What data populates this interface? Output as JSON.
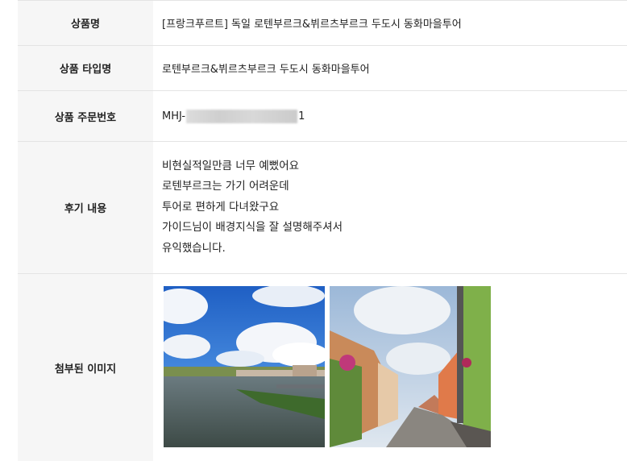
{
  "rows": {
    "product_name": {
      "label": "상품명",
      "value": "[프랑크푸르트] 독일 로텐부르크&뷔르츠부르크 두도시 동화마을투어"
    },
    "product_type": {
      "label": "상품 타입명",
      "value": "로텐부르크&뷔르츠부르크 두도시 동화마을투어"
    },
    "order_number": {
      "label": "상품 주문번호",
      "prefix": "MHJ-",
      "suffix": "1"
    },
    "review": {
      "label": "후기 내용",
      "lines": [
        "비현실적일만큼 너무 예뻤어요",
        "로텐부르크는 가기 어려운데",
        "투어로 편하게 다녀왔구요",
        "가이드님이 배경지식을 잘 설명해주셔서",
        "유익했습니다."
      ]
    },
    "images": {
      "label": "첨부된 이미지"
    }
  },
  "colors": {
    "label_bg": "#f6f6f6",
    "border": "#e4e4e4",
    "sky": "#2f6fd0",
    "water": "#4a5a55"
  }
}
